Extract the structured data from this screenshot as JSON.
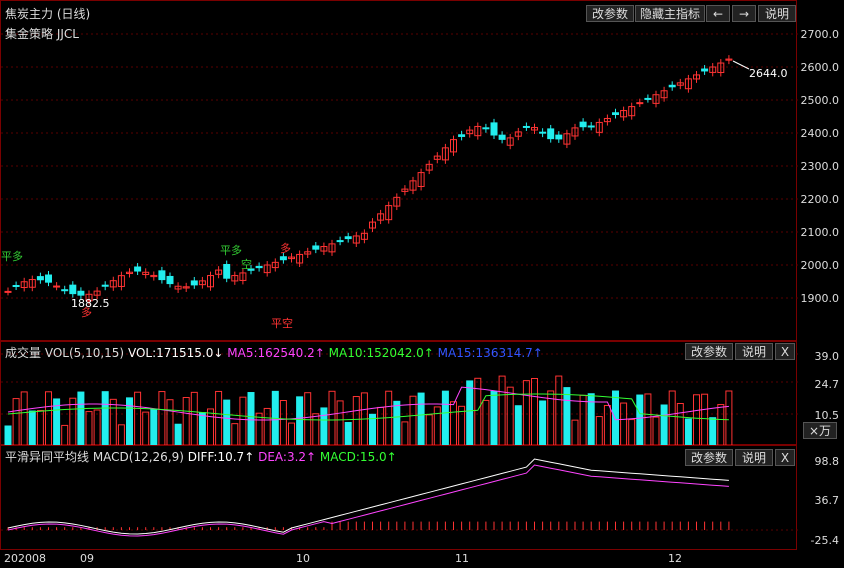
{
  "main": {
    "title": "焦炭主力 (日线)",
    "strategy": "集金策略 JJCL",
    "buttons": {
      "params": "改参数",
      "hide_indicator": "隐藏主指标",
      "prev": "←",
      "next": "→",
      "help": "说明"
    },
    "price_ticks": [
      "2700.0",
      "2600.0",
      "2500.0",
      "2400.0",
      "2300.0",
      "2200.0",
      "2100.0",
      "2000.0",
      "1900.0"
    ],
    "last_price_label": "2644.0",
    "low_label": "1882.5",
    "signals": [
      {
        "text": "平多",
        "color": "#33cc33"
      },
      {
        "text": "多",
        "color": "#ff3333"
      },
      {
        "text": "平多",
        "color": "#33cc33"
      },
      {
        "text": "空",
        "color": "#33cc33"
      },
      {
        "text": "多",
        "color": "#ff3333"
      },
      {
        "text": "平空",
        "color": "#ff3333"
      }
    ]
  },
  "volume": {
    "title": "成交量 VOL(5,10,15)",
    "vol": "VOL:171515.0↓",
    "ma5": "MA5:162540.2↑",
    "ma10": "MA10:152042.0↑",
    "ma15": "MA15:136314.7↑",
    "colors": {
      "vol": "#ffffff",
      "ma5": "#ff44ff",
      "ma10": "#33ff33",
      "ma15": "#3355ff"
    },
    "buttons": {
      "params": "改参数",
      "help": "说明",
      "close": "X"
    },
    "ticks": [
      "39.0",
      "24.7",
      "10.5"
    ],
    "unit": "×万"
  },
  "macd": {
    "title": "平滑异同平均线 MACD(12,26,9)",
    "diff": "DIFF:10.7↑",
    "dea": "DEA:3.2↑",
    "macd": "MACD:15.0↑",
    "colors": {
      "diff": "#ffffff",
      "dea": "#ff44ff",
      "macd": "#33ff33"
    },
    "buttons": {
      "params": "改参数",
      "help": "说明",
      "close": "X"
    },
    "ticks": [
      "98.8",
      "36.7",
      "-25.4"
    ]
  },
  "xaxis": [
    "202008",
    "09",
    "10",
    "11",
    "12"
  ],
  "colors": {
    "up": "#ff3333",
    "down": "#22eeee",
    "border": "#7a0000",
    "grid": "#5a0000"
  }
}
